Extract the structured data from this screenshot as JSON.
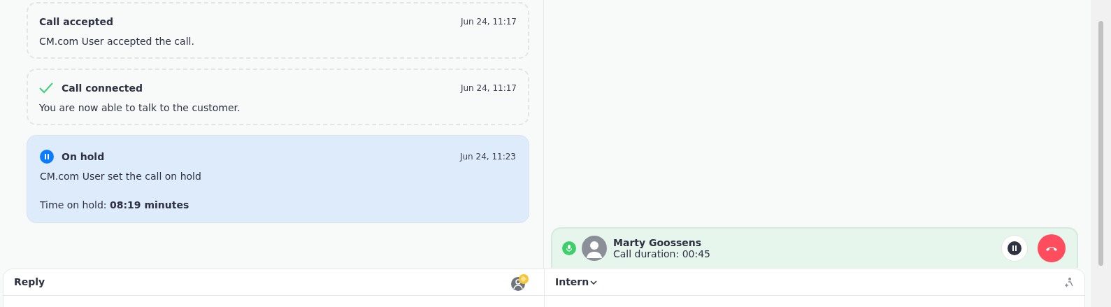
{
  "events": [
    {
      "kind": "plain",
      "title": "Call accepted",
      "time": "Jun 24, 11:17",
      "lines": [
        "CM.com User accepted the call."
      ]
    },
    {
      "kind": "connected",
      "title": "Call connected",
      "time": "Jun 24, 11:17",
      "lines": [
        "You are now able to talk to the customer."
      ]
    },
    {
      "kind": "hold",
      "title": "On hold",
      "time": "Jun 24, 11:23",
      "lines": [
        "CM.com User set the call on hold",
        "Time on hold: **08:19 minutes**"
      ]
    }
  ],
  "call": {
    "name": "Marty Goossens",
    "duration": "Call duration: 00:45",
    "muted": false
  },
  "composer": {
    "reply_label": "Reply",
    "intern_label": "Intern"
  }
}
